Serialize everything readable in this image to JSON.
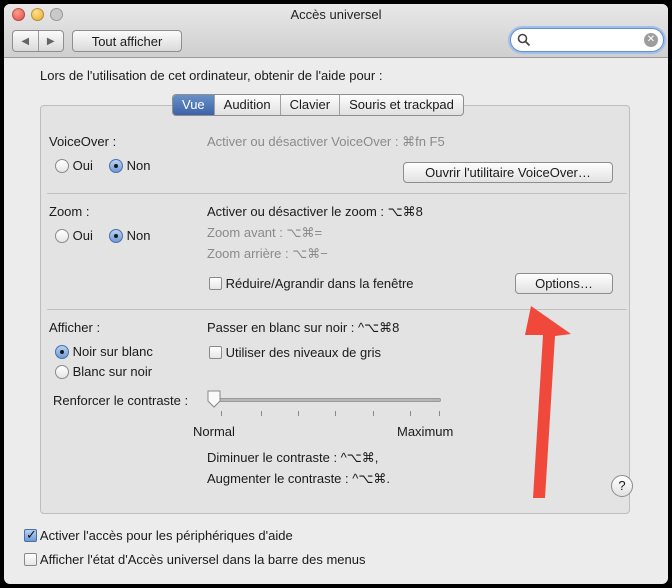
{
  "window": {
    "title": "Accès universel"
  },
  "toolbar": {
    "back": "◀",
    "forward": "▶",
    "show_all": "Tout afficher",
    "search_value": ""
  },
  "intro": "Lors de l'utilisation de cet ordinateur, obtenir de l'aide pour :",
  "tabs": [
    {
      "label": "Vue",
      "active": true
    },
    {
      "label": "Audition",
      "active": false
    },
    {
      "label": "Clavier",
      "active": false
    },
    {
      "label": "Souris et trackpad",
      "active": false
    }
  ],
  "voiceover": {
    "label": "VoiceOver :",
    "yes": "Oui",
    "no": "Non",
    "selected": "Non",
    "shortcut": "Activer ou désactiver VoiceOver : ⌘fn F5",
    "button": "Ouvrir l'utilitaire VoiceOver…"
  },
  "zoom": {
    "label": "Zoom :",
    "yes": "Oui",
    "no": "Non",
    "selected": "Non",
    "shortcut": "Activer ou désactiver le zoom : ⌥⌘8",
    "zoom_in": "Zoom avant : ⌥⌘=",
    "zoom_out": "Zoom arrière : ⌥⌘−",
    "window_check": "Réduire/Agrandir dans la fenêtre",
    "window_checked": false,
    "options_button": "Options…"
  },
  "display": {
    "label": "Afficher :",
    "black_on_white": "Noir sur blanc",
    "white_on_black": "Blanc sur noir",
    "selected": "Noir sur blanc",
    "invert_shortcut": "Passer en blanc sur noir : ^⌥⌘8",
    "grayscale": "Utiliser des niveaux de gris",
    "grayscale_checked": false,
    "contrast_label": "Renforcer le contraste :",
    "contrast_value": 0,
    "contrast_min": "Normal",
    "contrast_max": "Maximum",
    "decrease": "Diminuer le contraste : ^⌥⌘,",
    "increase": "Augmenter le contraste : ^⌥⌘."
  },
  "help": "?",
  "bottom": {
    "assistive": "Activer l'accès pour les périphériques d'aide",
    "assistive_checked": true,
    "menubar": "Afficher l'état d'Accès universel dans la barre des menus",
    "menubar_checked": false
  },
  "colors": {
    "annotation_arrow": "#f0493c",
    "tab_active": "#4a72b4"
  }
}
